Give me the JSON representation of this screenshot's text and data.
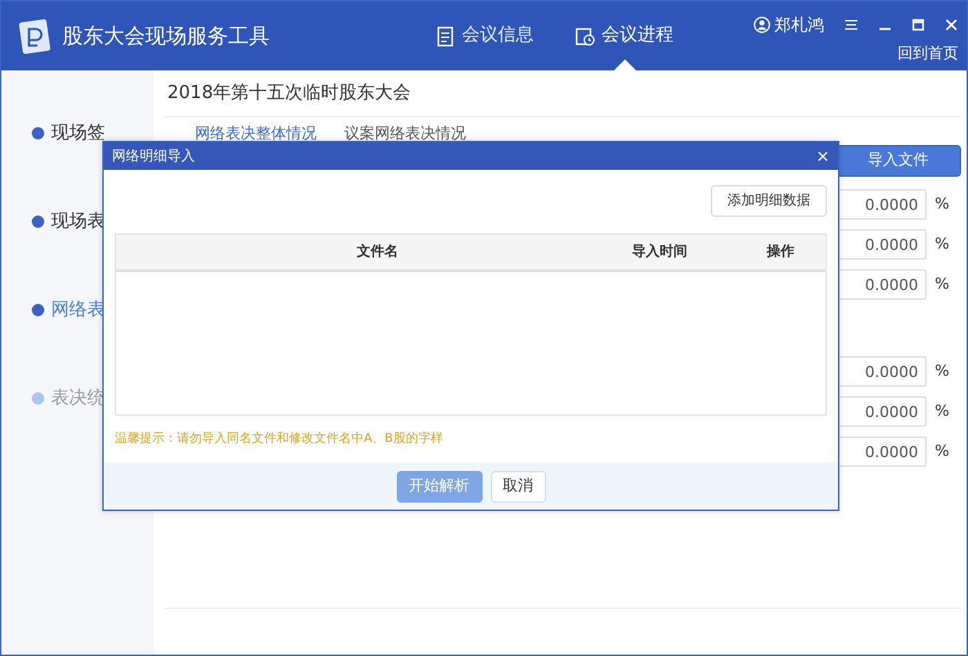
{
  "app": {
    "title": "股东大会现场服务工具"
  },
  "nav": [
    {
      "label": "会议信息",
      "selected": false
    },
    {
      "label": "会议进程",
      "selected": true
    }
  ],
  "user": {
    "name": "郑札鸿"
  },
  "home_link": "回到首页",
  "steps": [
    {
      "label": "现场签",
      "done": true,
      "selected": false
    },
    {
      "label": "现场表",
      "done": true,
      "selected": false
    },
    {
      "label": "网络表",
      "done": true,
      "selected": true
    },
    {
      "label": "表决统",
      "done": false,
      "selected": false
    }
  ],
  "meeting_title": "2018年第十五次临时股东大会",
  "tabs": [
    {
      "label": "网络表决整体情况",
      "selected": true
    },
    {
      "label": "议案网络表决情况",
      "selected": false
    }
  ],
  "import_button": "导入文件",
  "ratio_groups": [
    [
      {
        "value": "0.0000",
        "unit": "%"
      },
      {
        "value": "0.0000",
        "unit": "%"
      },
      {
        "value": "0.0000",
        "unit": "%"
      }
    ],
    [
      {
        "value": "0.0000",
        "unit": "%"
      },
      {
        "value": "0.0000",
        "unit": "%"
      },
      {
        "value": "0.0000",
        "unit": "%"
      }
    ]
  ],
  "dialog": {
    "title": "网络明细导入",
    "close": "×",
    "add_button": "添加明细数据",
    "columns": [
      "文件名",
      "导入时间",
      "操作"
    ],
    "hint": "温馨提示：请勿导入同名文件和修改文件名中A、B股的字样",
    "buttons": [
      {
        "label": "开始解析",
        "kind": "primary"
      },
      {
        "label": "取消",
        "kind": "secondary"
      }
    ]
  }
}
